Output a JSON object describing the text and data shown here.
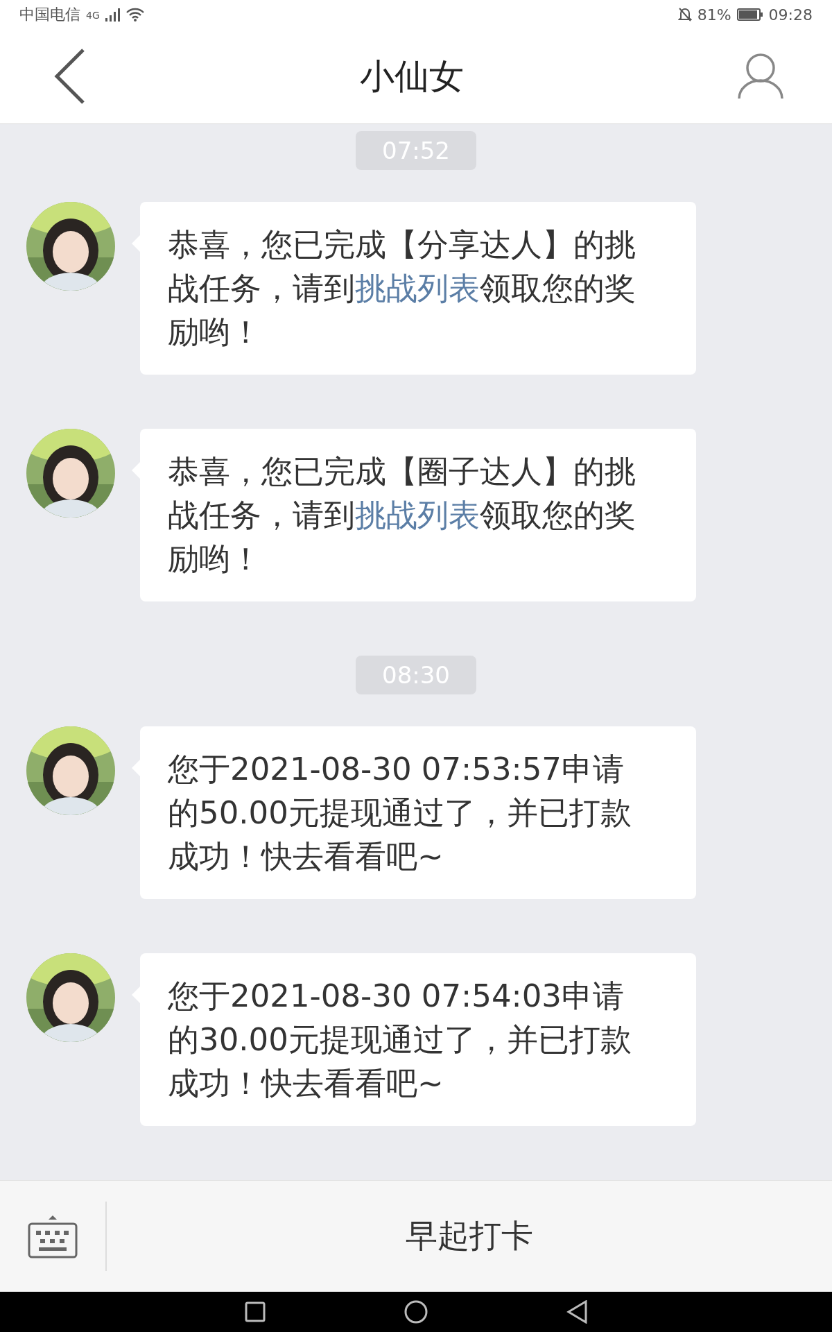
{
  "status_bar": {
    "carrier": "中国电信",
    "network": "4G",
    "battery": "81%",
    "time": "09:28"
  },
  "header": {
    "title": "小仙女"
  },
  "feed": [
    {
      "kind": "time",
      "text": "07:52"
    },
    {
      "kind": "message",
      "parts": [
        {
          "text": "恭喜，您已完成【分享达人】的挑战任务，请到",
          "link": false
        },
        {
          "text": "挑战列表",
          "link": true
        },
        {
          "text": "领取您的奖励哟！",
          "link": false
        }
      ]
    },
    {
      "kind": "message",
      "parts": [
        {
          "text": "恭喜，您已完成【圈子达人】的挑战任务，请到",
          "link": false
        },
        {
          "text": "挑战列表",
          "link": true
        },
        {
          "text": "领取您的奖励哟！",
          "link": false
        }
      ]
    },
    {
      "kind": "time",
      "text": "08:30"
    },
    {
      "kind": "message",
      "parts": [
        {
          "text": "您于2021-08-30 07:53:57申请的50.00元提现通过了，并已打款成功！快去看看吧~",
          "link": false
        }
      ]
    },
    {
      "kind": "message",
      "parts": [
        {
          "text": "您于2021-08-30 07:54:03申请的30.00元提现通过了，并已打款成功！快去看看吧~",
          "link": false
        }
      ]
    }
  ],
  "bottom_bar": {
    "menu_label": "早起打卡"
  }
}
